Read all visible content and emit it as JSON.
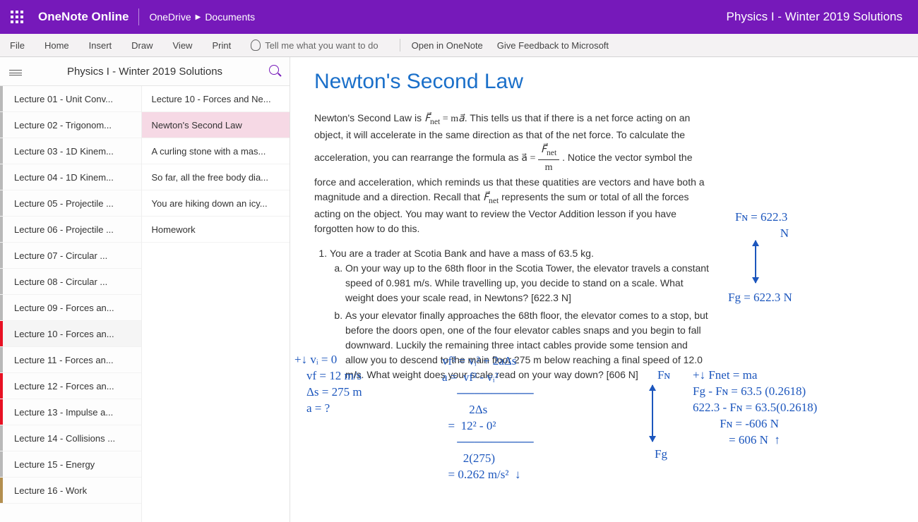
{
  "header": {
    "brand": "OneNote Online",
    "breadcrumb_root": "OneDrive",
    "breadcrumb_leaf": "Documents",
    "doc_title": "Physics I - Winter 2019 Solutions"
  },
  "tabs": {
    "file": "File",
    "home": "Home",
    "insert": "Insert",
    "draw": "Draw",
    "view": "View",
    "print": "Print",
    "tellme_placeholder": "Tell me what you want to do",
    "open_in": "Open in OneNote",
    "feedback": "Give Feedback to Microsoft"
  },
  "sidebar": {
    "notebook_title": "Physics I - Winter 2019 Solutions",
    "sections": [
      "Lecture 01 - Unit Conv...",
      "Lecture 02 - Trigonom...",
      "Lecture 03 - 1D Kinem...",
      "Lecture 04 - 1D Kinem...",
      "Lecture 05 - Projectile ...",
      "Lecture 06 - Projectile ...",
      "Lecture 07 - Circular ...",
      "Lecture 08 - Circular ...",
      "Lecture 09 - Forces an...",
      "Lecture 10 - Forces an...",
      "Lecture 11 - Forces an...",
      "Lecture 12 - Forces an...",
      "Lecture 13 - Impulse a...",
      "Lecture 14 - Collisions ...",
      "Lecture 15 - Energy",
      "Lecture 16 - Work"
    ],
    "selected_section_index": 9,
    "pages": [
      "Lecture 10 - Forces and Ne...",
      "Newton's Second Law",
      "A curling stone with a mas...",
      "So far, all the free body dia...",
      "You are hiking down an icy...",
      "Homework"
    ],
    "selected_page_index": 1
  },
  "page": {
    "title": "Newton's Second Law",
    "intro_1a": "Newton's Second Law is ",
    "intro_1b": ". This tells us that if there is a net force acting on an object, it will accelerate in the same direction as that of the net force. To calculate the acceleration, you can rearrange the formula as ",
    "intro_1c": " .  Notice the vector symbol the force and acceleration, which reminds us that these quatities are vectors and have both a magnitude and a direction. Recall that ",
    "intro_1d": " represents the sum or total of all the forces acting on the object. You may want to review the Vector Addition lesson if you have forgotten how to do this.",
    "eq_fma_lhs": "F⃗",
    "eq_fma_sub": "net",
    "eq_fma_mid": " = m",
    "eq_fma_rhs": "a⃗",
    "eq_a_lhs": "a⃗ = ",
    "eq_a_num": "F⃗",
    "eq_a_numsub": "net",
    "eq_a_den": "m",
    "fnet_sym": "F⃗",
    "fnet_sub": "net",
    "q1_stem": "You are a trader at Scotia Bank and have a mass of 63.5 kg.",
    "q1a": "On your way up to the 68th floor in the Scotia Tower, the elevator travels a constant speed of 0.981 m/s. While travelling up, you decide to stand on a scale. What weight does your scale read, in Newtons? [622.3 N]",
    "q1b": "As your elevator finally approaches the 68th floor, the elevator comes to a stop, but before the doors open, one of the four elevator cables snaps and you begin to fall downward. Luckily the remaining three intact cables provide some tension and allow you to descend to the main floor 275 m below reaching a final speed of 12.0 m/s. What weight does your scale read on your way down? [606 N]"
  },
  "ink": {
    "fn_top": "Fɴ = 622.3\n               N",
    "fg_top": "Fg = 622.3 N",
    "left_block": "+↓ vᵢ = 0\n    vf = 12 m/s\n    Δs = 275 m\n    a = ?",
    "mid_block": "vf² = vᵢ² + 2aΔs\na =  vf² - vᵢ²\n     ─────────\n         2Δs\n  =  12² - 0²\n     ─────────\n       2(275)\n  = 0.262 m/s²  ↓",
    "fn_label": "Fɴ",
    "fg_label": "Fg",
    "right_block": "+↓ Fnet = ma\nFg - Fɴ = 63.5 (0.2618)\n622.3 - Fɴ = 63.5(0.2618)\n         Fɴ = -606 N\n            = 606 N  ↑"
  }
}
